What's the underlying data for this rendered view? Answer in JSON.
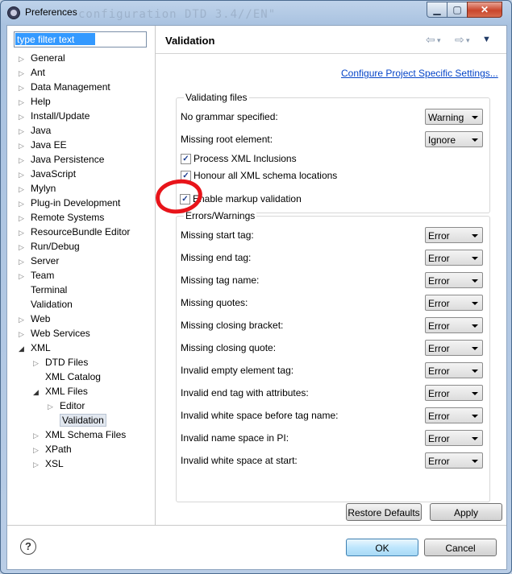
{
  "window": {
    "title": "Preferences",
    "ghost_text": "configuration DTD 3.4//EN\"",
    "min_icon": "minimize-icon",
    "max_icon": "maximize-icon",
    "close_icon": "close-icon"
  },
  "filter": {
    "value": "type filter text"
  },
  "tree": [
    {
      "label": "General",
      "depth": 0,
      "twisty": "closed"
    },
    {
      "label": "Ant",
      "depth": 0,
      "twisty": "closed"
    },
    {
      "label": "Data Management",
      "depth": 0,
      "twisty": "closed"
    },
    {
      "label": "Help",
      "depth": 0,
      "twisty": "closed"
    },
    {
      "label": "Install/Update",
      "depth": 0,
      "twisty": "closed"
    },
    {
      "label": "Java",
      "depth": 0,
      "twisty": "closed"
    },
    {
      "label": "Java EE",
      "depth": 0,
      "twisty": "closed"
    },
    {
      "label": "Java Persistence",
      "depth": 0,
      "twisty": "closed"
    },
    {
      "label": "JavaScript",
      "depth": 0,
      "twisty": "closed"
    },
    {
      "label": "Mylyn",
      "depth": 0,
      "twisty": "closed"
    },
    {
      "label": "Plug-in Development",
      "depth": 0,
      "twisty": "closed"
    },
    {
      "label": "Remote Systems",
      "depth": 0,
      "twisty": "closed"
    },
    {
      "label": "ResourceBundle Editor",
      "depth": 0,
      "twisty": "closed"
    },
    {
      "label": "Run/Debug",
      "depth": 0,
      "twisty": "closed"
    },
    {
      "label": "Server",
      "depth": 0,
      "twisty": "closed"
    },
    {
      "label": "Team",
      "depth": 0,
      "twisty": "closed"
    },
    {
      "label": "Terminal",
      "depth": 0,
      "twisty": "none"
    },
    {
      "label": "Validation",
      "depth": 0,
      "twisty": "none"
    },
    {
      "label": "Web",
      "depth": 0,
      "twisty": "closed"
    },
    {
      "label": "Web Services",
      "depth": 0,
      "twisty": "closed"
    },
    {
      "label": "XML",
      "depth": 0,
      "twisty": "open"
    },
    {
      "label": "DTD Files",
      "depth": 1,
      "twisty": "closed"
    },
    {
      "label": "XML Catalog",
      "depth": 1,
      "twisty": "none"
    },
    {
      "label": "XML Files",
      "depth": 1,
      "twisty": "open"
    },
    {
      "label": "Editor",
      "depth": 2,
      "twisty": "closed"
    },
    {
      "label": "Validation",
      "depth": 2,
      "twisty": "none",
      "selected": true
    },
    {
      "label": "XML Schema Files",
      "depth": 1,
      "twisty": "closed"
    },
    {
      "label": "XPath",
      "depth": 1,
      "twisty": "closed"
    },
    {
      "label": "XSL",
      "depth": 1,
      "twisty": "closed"
    }
  ],
  "page": {
    "title": "Validation",
    "back_icon": "back-arrow-icon",
    "forward_icon": "forward-arrow-icon",
    "menu_icon": "view-menu-icon",
    "configure_link": "Configure Project Specific Settings..."
  },
  "validating_files": {
    "title": "Validating files",
    "rows": [
      {
        "label": "No grammar specified:",
        "value": "Warning"
      },
      {
        "label": "Missing root element:",
        "value": "Ignore"
      }
    ],
    "checks": [
      {
        "label": "Process XML Inclusions",
        "checked": true
      },
      {
        "label": "Honour all XML schema locations",
        "checked": true
      }
    ]
  },
  "markup": {
    "label": "Enable markup validation",
    "checked": true
  },
  "errors": {
    "title": "Errors/Warnings",
    "rows": [
      {
        "label": "Missing start tag:",
        "value": "Error"
      },
      {
        "label": "Missing end tag:",
        "value": "Error"
      },
      {
        "label": "Missing tag name:",
        "value": "Error"
      },
      {
        "label": "Missing quotes:",
        "value": "Error"
      },
      {
        "label": "Missing closing bracket:",
        "value": "Error"
      },
      {
        "label": "Missing closing quote:",
        "value": "Error"
      },
      {
        "label": "Invalid empty element tag:",
        "value": "Error"
      },
      {
        "label": "Invalid end tag with attributes:",
        "value": "Error"
      },
      {
        "label": "Invalid white space before tag name:",
        "value": "Error"
      },
      {
        "label": "Invalid name space in PI:",
        "value": "Error"
      },
      {
        "label": "Invalid white space at start:",
        "value": "Error"
      }
    ]
  },
  "buttons": {
    "restore": "Restore Defaults",
    "apply": "Apply",
    "ok": "OK",
    "cancel": "Cancel",
    "help_glyph": "?",
    "help_icon": "help-icon"
  },
  "annotation": {
    "color": "#e8141a"
  }
}
